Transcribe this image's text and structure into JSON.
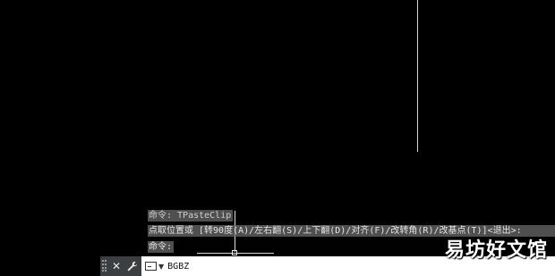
{
  "history": {
    "line1": "命令: TPasteClip",
    "line2": "点取位置或 [转90度(A)/左右翻(S)/上下翻(D)/对齐(F)/改转角(R)/改基点(T)]<退出>:",
    "line3": "命令:"
  },
  "command_line": {
    "close_glyph": "✕",
    "settings_glyph": "🔧",
    "input_value": "BGBZ",
    "icons": [
      "grip-icon",
      "close-icon",
      "wrench-icon",
      "command-prompt-icon",
      "caret-down-icon"
    ]
  },
  "watermark": "易坊好文馆",
  "colors": {
    "canvas": "#000000",
    "history_bg": "#6e6e6e",
    "bar_left": "#3c3f41",
    "input_bg": "#ffffff"
  }
}
